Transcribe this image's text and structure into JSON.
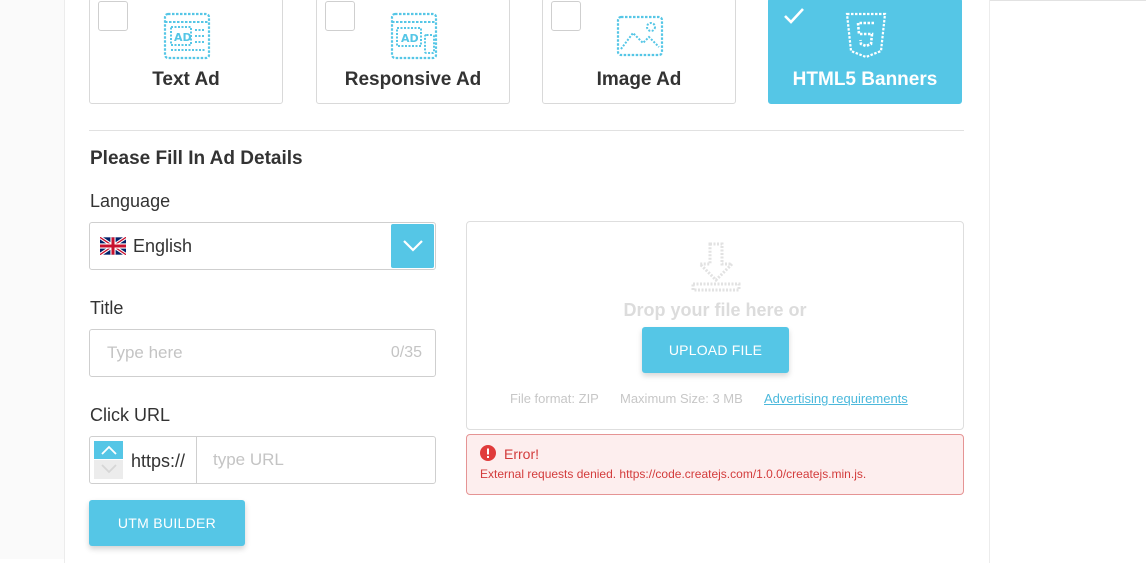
{
  "ad_types": [
    {
      "label": "Text Ad",
      "icon": "text-ad-icon",
      "selected": false
    },
    {
      "label": "Responsive Ad",
      "icon": "responsive-ad-icon",
      "selected": false
    },
    {
      "label": "Image Ad",
      "icon": "image-ad-icon",
      "selected": false
    },
    {
      "label": "HTML5 Banners",
      "icon": "html5-icon",
      "selected": true
    }
  ],
  "form": {
    "section_title": "Please Fill In Ad Details",
    "language": {
      "label": "Language",
      "value": "English",
      "flag": "uk-flag-icon"
    },
    "title": {
      "label": "Title",
      "placeholder": "Type here",
      "counter": "0/35"
    },
    "click_url": {
      "label": "Click URL",
      "protocol": "https://",
      "placeholder": "type URL"
    },
    "utm_button": "UTM BUILDER"
  },
  "upload": {
    "drop_text": "Drop your file here or",
    "button": "UPLOAD FILE",
    "file_format": "File format: ZIP",
    "max_size": "Maximum Size: 3 MB",
    "requirements_link": "Advertising requirements"
  },
  "error": {
    "title": "Error!",
    "message": "External requests denied. https://code.createjs.com/1.0.0/createjs.min.js."
  },
  "colors": {
    "accent": "#55c6e6",
    "error_text": "#d33c3c",
    "error_bg": "#fdeeee",
    "error_border": "#e59494"
  }
}
